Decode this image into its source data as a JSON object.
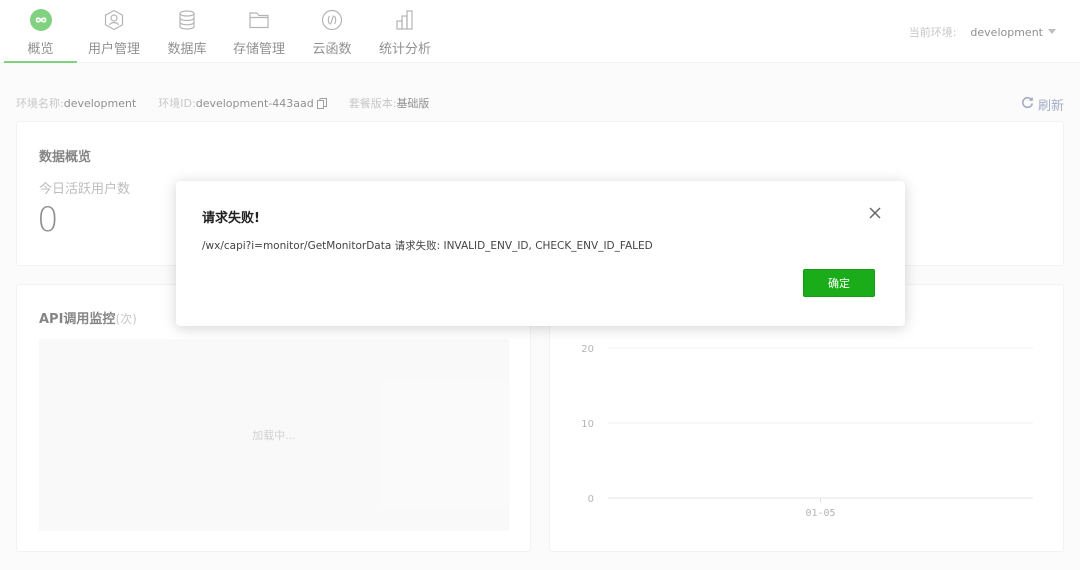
{
  "nav": {
    "tabs": [
      {
        "label": "概览",
        "icon": "overview-infinity-icon",
        "active": true
      },
      {
        "label": "用户管理",
        "icon": "user-management-icon",
        "active": false
      },
      {
        "label": "数据库",
        "icon": "database-icon",
        "active": false
      },
      {
        "label": "存储管理",
        "icon": "folder-icon",
        "active": false
      },
      {
        "label": "云函数",
        "icon": "cloud-function-icon",
        "active": false
      },
      {
        "label": "统计分析",
        "icon": "bar-chart-icon",
        "active": false
      }
    ],
    "env_label": "当前环境:",
    "env_value": "development"
  },
  "info": {
    "env_name_label": "环境名称:",
    "env_name": "development",
    "env_id_label": "环境ID:",
    "env_id": "development-443aad",
    "plan_label": "套餐版本:",
    "plan": "基础版",
    "refresh_label": "刷新"
  },
  "overview": {
    "title": "数据概览",
    "metric_label": "今日活跃用户数",
    "metric_value": "0"
  },
  "api": {
    "title": "API调用监控",
    "unit": "(次)",
    "loading_text": "加载中..."
  },
  "chart_data": {
    "type": "line",
    "x": [
      "01-05"
    ],
    "yticks": [
      0,
      10,
      20
    ],
    "ylim": [
      0,
      20
    ],
    "series": []
  },
  "dialog": {
    "title": "请求失败!",
    "message": "/wx/capi?i=monitor/GetMonitorData 请求失败: INVALID_ENV_ID, CHECK_ENV_ID_FALED",
    "ok_label": "确定"
  },
  "colors": {
    "brand_green": "#1aad19",
    "link_blue": "#576b95"
  }
}
